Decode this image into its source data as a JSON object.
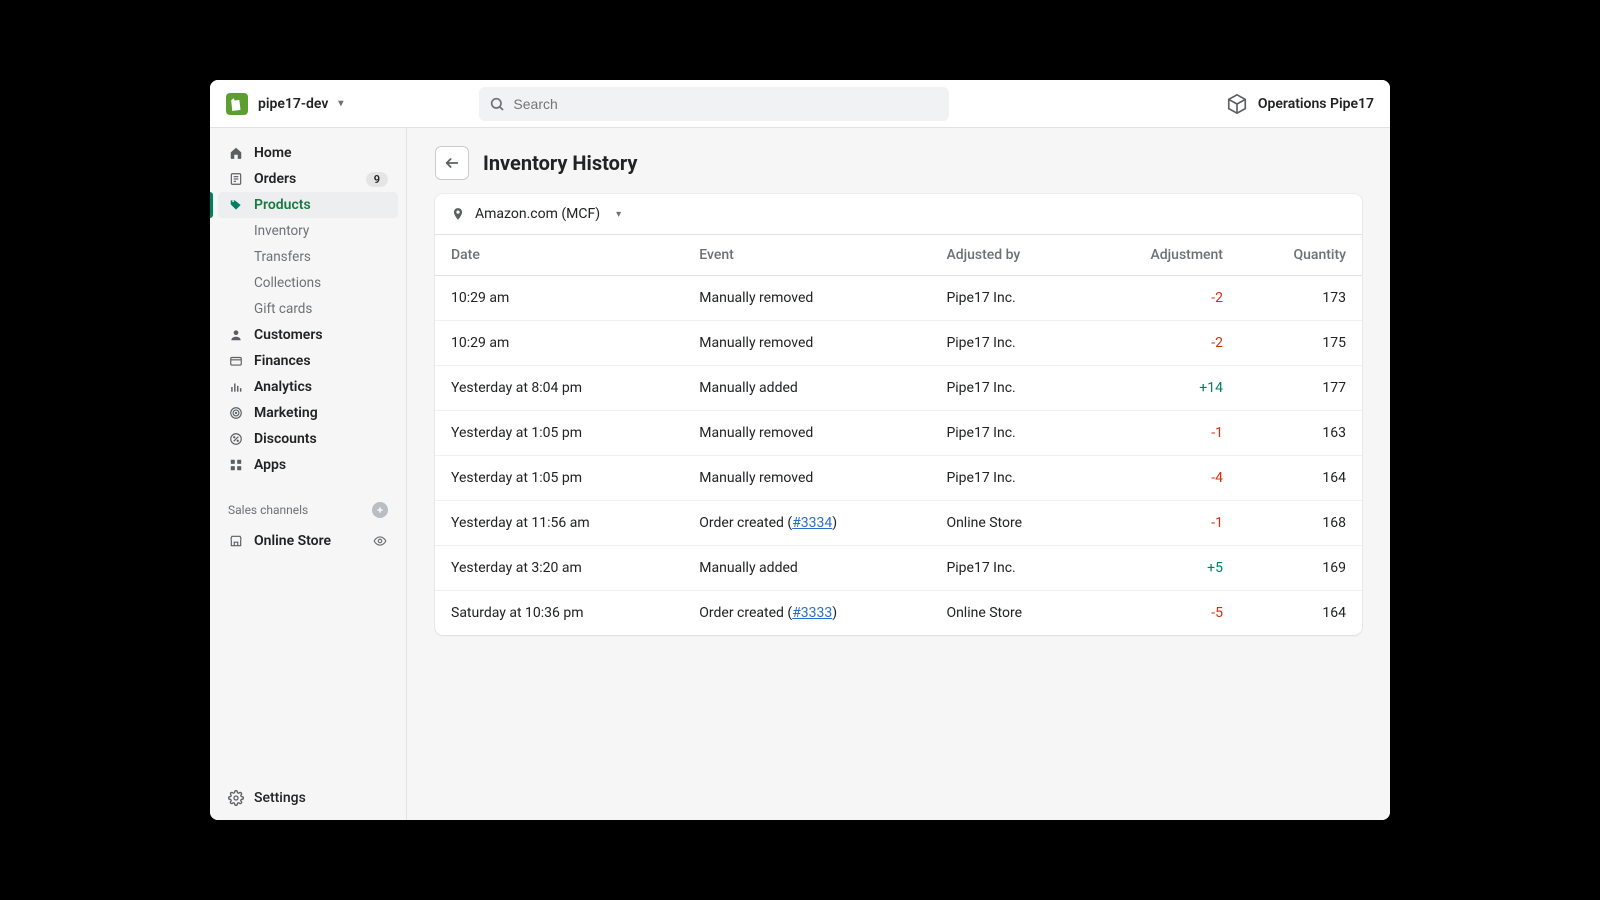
{
  "header": {
    "store_name": "pipe17-dev",
    "search_placeholder": "Search",
    "account_label": "Operations Pipe17"
  },
  "sidebar": {
    "items": [
      {
        "label": "Home",
        "icon": "home-icon"
      },
      {
        "label": "Orders",
        "icon": "orders-icon",
        "badge": "9"
      },
      {
        "label": "Products",
        "icon": "tag-icon",
        "active": true,
        "children": [
          {
            "label": "Inventory"
          },
          {
            "label": "Transfers"
          },
          {
            "label": "Collections"
          },
          {
            "label": "Gift cards"
          }
        ]
      },
      {
        "label": "Customers",
        "icon": "person-icon"
      },
      {
        "label": "Finances",
        "icon": "finances-icon"
      },
      {
        "label": "Analytics",
        "icon": "analytics-icon"
      },
      {
        "label": "Marketing",
        "icon": "target-icon"
      },
      {
        "label": "Discounts",
        "icon": "discount-icon"
      },
      {
        "label": "Apps",
        "icon": "apps-icon"
      }
    ],
    "channels_label": "Sales channels",
    "channels": [
      {
        "label": "Online Store",
        "icon": "store-icon"
      }
    ],
    "settings_label": "Settings"
  },
  "page": {
    "title": "Inventory History",
    "location": "Amazon.com (MCF)",
    "columns": {
      "date": "Date",
      "event": "Event",
      "adjusted_by": "Adjusted by",
      "adjustment": "Adjustment",
      "quantity": "Quantity"
    },
    "rows": [
      {
        "date": "10:29 am",
        "event_text": "Manually removed",
        "order_link": null,
        "adjusted_by": "Pipe17 Inc.",
        "adjustment": "-2",
        "adj_sign": "neg",
        "quantity": "173"
      },
      {
        "date": "10:29 am",
        "event_text": "Manually removed",
        "order_link": null,
        "adjusted_by": "Pipe17 Inc.",
        "adjustment": "-2",
        "adj_sign": "neg",
        "quantity": "175"
      },
      {
        "date": "Yesterday at 8:04 pm",
        "event_text": "Manually added",
        "order_link": null,
        "adjusted_by": "Pipe17 Inc.",
        "adjustment": "+14",
        "adj_sign": "pos",
        "quantity": "177"
      },
      {
        "date": "Yesterday at 1:05 pm",
        "event_text": "Manually removed",
        "order_link": null,
        "adjusted_by": "Pipe17 Inc.",
        "adjustment": "-1",
        "adj_sign": "neg",
        "quantity": "163"
      },
      {
        "date": "Yesterday at 1:05 pm",
        "event_text": "Manually removed",
        "order_link": null,
        "adjusted_by": "Pipe17 Inc.",
        "adjustment": "-4",
        "adj_sign": "neg",
        "quantity": "164"
      },
      {
        "date": "Yesterday at 11:56 am",
        "event_text": "Order created",
        "order_link": "#3334",
        "adjusted_by": "Online Store",
        "adjustment": "-1",
        "adj_sign": "neg",
        "quantity": "168"
      },
      {
        "date": "Yesterday at 3:20 am",
        "event_text": "Manually added",
        "order_link": null,
        "adjusted_by": "Pipe17 Inc.",
        "adjustment": "+5",
        "adj_sign": "pos",
        "quantity": "169"
      },
      {
        "date": "Saturday at 10:36 pm",
        "event_text": "Order created",
        "order_link": "#3333",
        "adjusted_by": "Online Store",
        "adjustment": "-5",
        "adj_sign": "neg",
        "quantity": "164"
      }
    ]
  }
}
